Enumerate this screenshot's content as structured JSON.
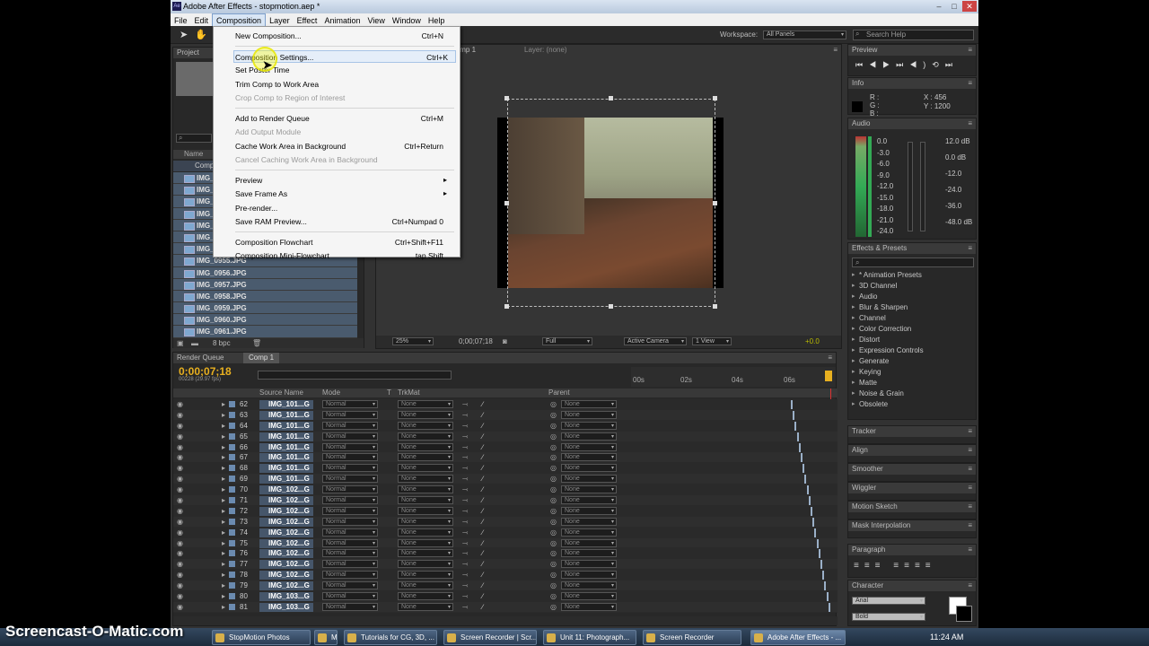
{
  "window": {
    "title": "Adobe After Effects - stopmotion.aep *"
  },
  "menubar": [
    "File",
    "Edit",
    "Composition",
    "Layer",
    "Effect",
    "Animation",
    "View",
    "Window",
    "Help"
  ],
  "toolbar": {
    "workspace_label": "Workspace:",
    "workspace_value": "All Panels",
    "search_placeholder": "Search Help"
  },
  "composition_menu": [
    {
      "label": "New Composition...",
      "shortcut": "Ctrl+N",
      "disabled": false
    },
    {
      "sep": true
    },
    {
      "label": "Composition Settings...",
      "shortcut": "Ctrl+K",
      "disabled": false,
      "highlight": true
    },
    {
      "label": "Set Poster Time",
      "shortcut": "",
      "disabled": false
    },
    {
      "label": "Trim Comp to Work Area",
      "shortcut": "",
      "disabled": false
    },
    {
      "label": "Crop Comp to Region of Interest",
      "shortcut": "",
      "disabled": true
    },
    {
      "sep": true
    },
    {
      "label": "Add to Render Queue",
      "shortcut": "Ctrl+M",
      "disabled": false
    },
    {
      "label": "Add Output Module",
      "shortcut": "",
      "disabled": true
    },
    {
      "label": "Cache Work Area in Background",
      "shortcut": "Ctrl+Return",
      "disabled": false
    },
    {
      "label": "Cancel Caching Work Area in Background",
      "shortcut": "",
      "disabled": true
    },
    {
      "sep": true
    },
    {
      "label": "Preview",
      "shortcut": "",
      "disabled": false,
      "submenu": true
    },
    {
      "label": "Save Frame As",
      "shortcut": "",
      "disabled": false,
      "submenu": true
    },
    {
      "label": "Pre-render...",
      "shortcut": "",
      "disabled": false
    },
    {
      "label": "Save RAM Preview...",
      "shortcut": "Ctrl+Numpad 0",
      "disabled": false
    },
    {
      "sep": true
    },
    {
      "label": "Composition Flowchart",
      "shortcut": "Ctrl+Shift+F11",
      "disabled": false
    },
    {
      "label": "Composition Mini-Flowchart",
      "shortcut": "tap Shift",
      "disabled": false
    }
  ],
  "project": {
    "tab": "Project",
    "name_col": "Name",
    "comp_item": "Comp",
    "files": [
      "IMG_",
      "IMG_",
      "IMG_",
      "IMG_",
      "IMG_",
      "IMG_",
      "IMG_",
      "IMG_0955.JPG",
      "IMG_0956.JPG",
      "IMG_0957.JPG",
      "IMG_0958.JPG",
      "IMG_0959.JPG",
      "IMG_0960.JPG",
      "IMG_0961.JPG"
    ],
    "bpc": "8 bpc"
  },
  "viewer": {
    "tab": "Comp 1",
    "layer_tab": "Layer: (none)",
    "zoom": "25%",
    "timecode": "0;00;07;18",
    "resolution": "Full",
    "camera": "Active Camera",
    "views": "1 View",
    "exposure": "+0.0"
  },
  "preview": {
    "tab": "Preview"
  },
  "info": {
    "tab": "Info",
    "r": "R :",
    "g": "G :",
    "b": "B :",
    "x": "X : 456",
    "y": "Y : 1200"
  },
  "audio": {
    "tab": "Audio",
    "left_scale": [
      "0.0",
      "-3.0",
      "-6.0",
      "-9.0",
      "-12.0",
      "-15.0",
      "-18.0",
      "-21.0",
      "-24.0"
    ],
    "right_scale": [
      "12.0 dB",
      "0.0 dB",
      "-12.0",
      "-24.0",
      "-36.0",
      "-48.0 dB"
    ]
  },
  "effects": {
    "tab": "Effects & Presets",
    "items": [
      "* Animation Presets",
      "3D Channel",
      "Audio",
      "Blur & Sharpen",
      "Channel",
      "Color Correction",
      "Distort",
      "Expression Controls",
      "Generate",
      "Keying",
      "Matte",
      "Noise & Grain",
      "Obsolete"
    ]
  },
  "side_panels": [
    "Tracker",
    "Align",
    "Smoother",
    "Wiggler",
    "Motion Sketch",
    "Mask Interpolation"
  ],
  "paragraph": {
    "tab": "Paragraph"
  },
  "character": {
    "tab": "Character",
    "font": "Arial",
    "style": "Bold"
  },
  "render_queue": {
    "tab": "Render Queue"
  },
  "timeline": {
    "tab": "Comp 1",
    "timecode": "0;00;07;18",
    "frame_info": "00228 (29.97 fps)",
    "headers": {
      "source": "Source Name",
      "mode": "Mode",
      "t": "T",
      "trkmat": "TrkMat",
      "parent": "Parent"
    },
    "ruler": [
      "00s",
      "02s",
      "04s",
      "06s"
    ],
    "layers": [
      {
        "num": "62",
        "name": "IMG_101...G"
      },
      {
        "num": "63",
        "name": "IMG_101...G"
      },
      {
        "num": "64",
        "name": "IMG_101...G"
      },
      {
        "num": "65",
        "name": "IMG_101...G"
      },
      {
        "num": "66",
        "name": "IMG_101...G"
      },
      {
        "num": "67",
        "name": "IMG_101...G"
      },
      {
        "num": "68",
        "name": "IMG_101...G"
      },
      {
        "num": "69",
        "name": "IMG_101...G"
      },
      {
        "num": "70",
        "name": "IMG_102...G"
      },
      {
        "num": "71",
        "name": "IMG_102...G"
      },
      {
        "num": "72",
        "name": "IMG_102...G"
      },
      {
        "num": "73",
        "name": "IMG_102...G"
      },
      {
        "num": "74",
        "name": "IMG_102...G"
      },
      {
        "num": "75",
        "name": "IMG_102...G"
      },
      {
        "num": "76",
        "name": "IMG_102...G"
      },
      {
        "num": "77",
        "name": "IMG_102...G"
      },
      {
        "num": "78",
        "name": "IMG_102...G"
      },
      {
        "num": "79",
        "name": "IMG_102...G"
      },
      {
        "num": "80",
        "name": "IMG_103...G"
      },
      {
        "num": "81",
        "name": "IMG_103...G"
      }
    ],
    "mode_value": "Normal",
    "trkmat_value": "None",
    "parent_value": "None"
  },
  "taskbar": {
    "watermark": "Screencast-O-Matic.com",
    "items": [
      "StopMotion Photos",
      "M",
      "Tutorials for CG, 3D, ...",
      "Screen Recorder | Scr...",
      "Unit 11: Photograph...",
      "Screen Recorder",
      "Adobe After Effects - ..."
    ],
    "time": "11:24 AM"
  }
}
